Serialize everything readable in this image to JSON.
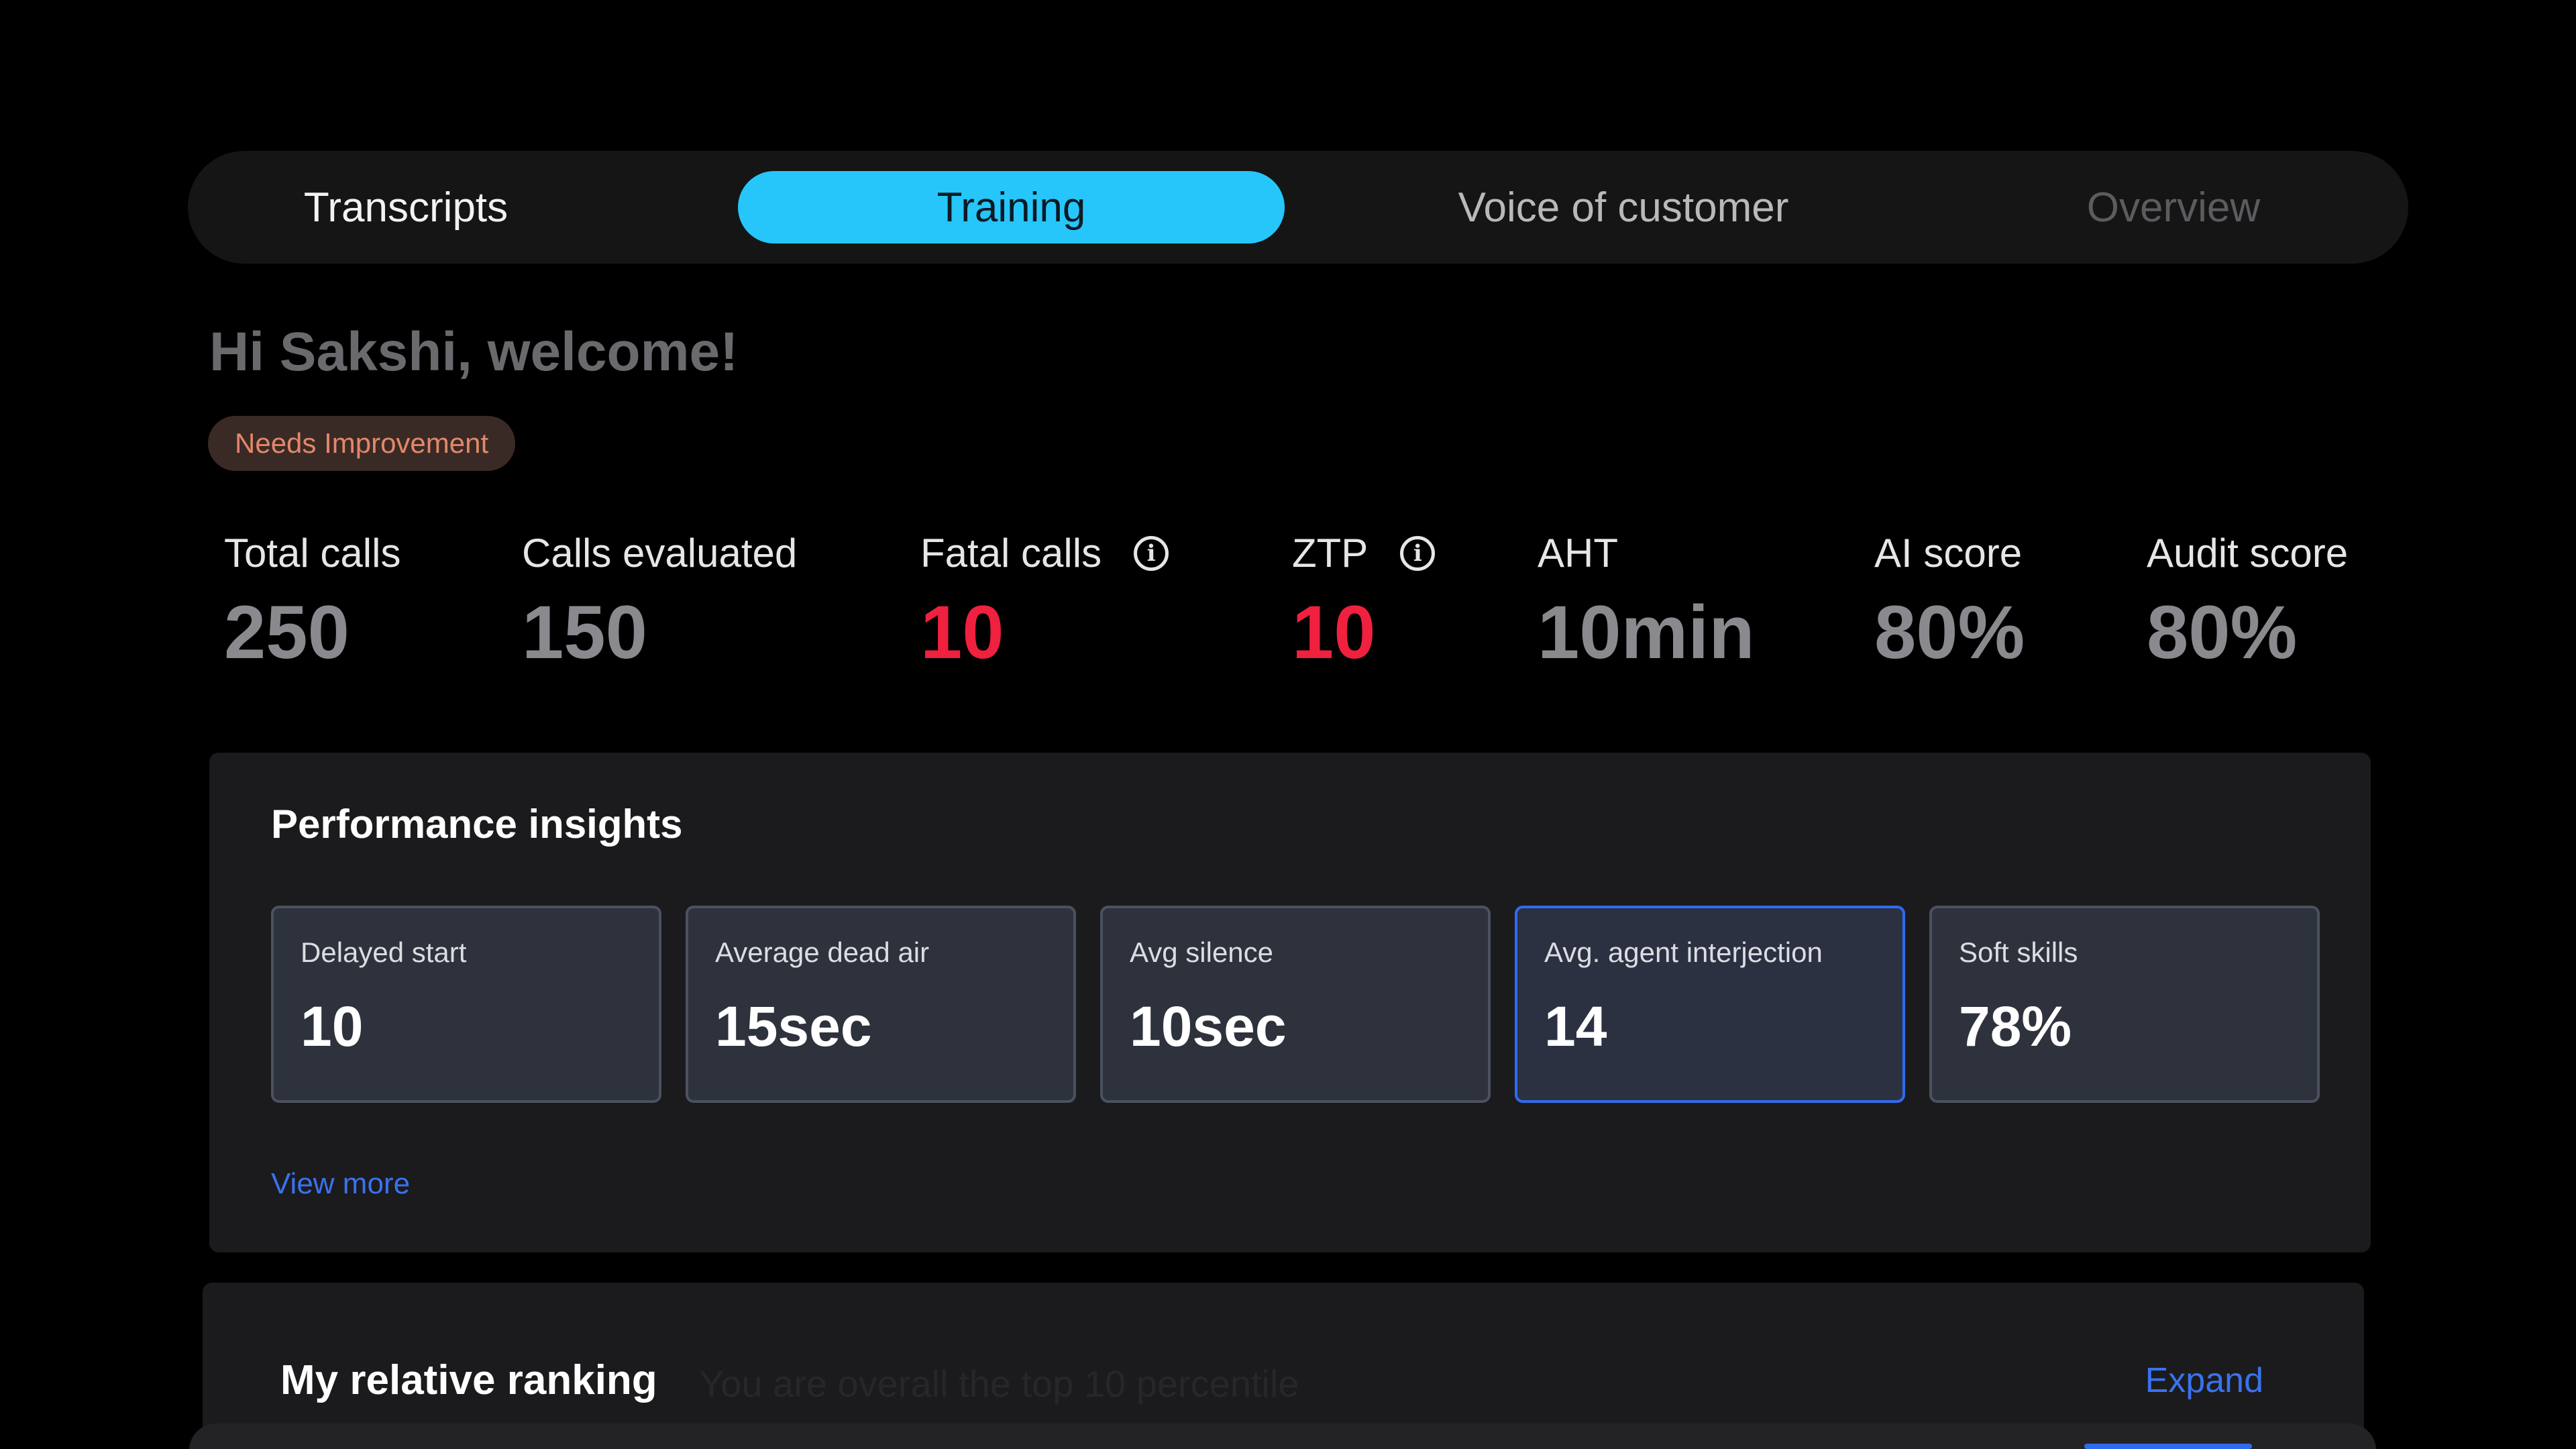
{
  "tabs": [
    {
      "label": "Transcripts",
      "active": false
    },
    {
      "label": "Training",
      "active": true
    },
    {
      "label": "Voice of customer",
      "active": false
    },
    {
      "label": "Overview",
      "active": false
    }
  ],
  "greeting": "Hi Sakshi, welcome!",
  "badge": "Needs Improvement",
  "metrics": [
    {
      "label": "Total calls",
      "value": "250"
    },
    {
      "label": "Calls evaluated",
      "value": "150"
    },
    {
      "label": "Fatal calls",
      "value": "10",
      "icon": "info-icon"
    },
    {
      "label": "ZTP",
      "value": "10",
      "icon": "info-icon"
    },
    {
      "label": "AHT",
      "value": "10min"
    },
    {
      "label": "AI score",
      "value": "80%"
    },
    {
      "label": "Audit score",
      "value": "80%"
    }
  ],
  "insights": {
    "title": "Performance insights",
    "cards": [
      {
        "label": "Delayed start",
        "value": "10"
      },
      {
        "label": "Average dead air",
        "value": "15sec"
      },
      {
        "label": "Avg silence",
        "value": "10sec"
      },
      {
        "label": "Avg. agent interjection",
        "value": "14"
      },
      {
        "label": "Soft skills",
        "value": "78%"
      }
    ],
    "view_more": "View more"
  },
  "ranking": {
    "title": "My relative ranking",
    "subtitle": "You are overall the top 10 percentile",
    "expand": "Expand"
  },
  "colors": {
    "background": "#000000",
    "accent_tab": "#26c6fa",
    "fatal_red": "#f0203f",
    "link_blue": "#3a72ee",
    "badge_text": "#e3876a",
    "badge_bg": "#3a2a25"
  }
}
